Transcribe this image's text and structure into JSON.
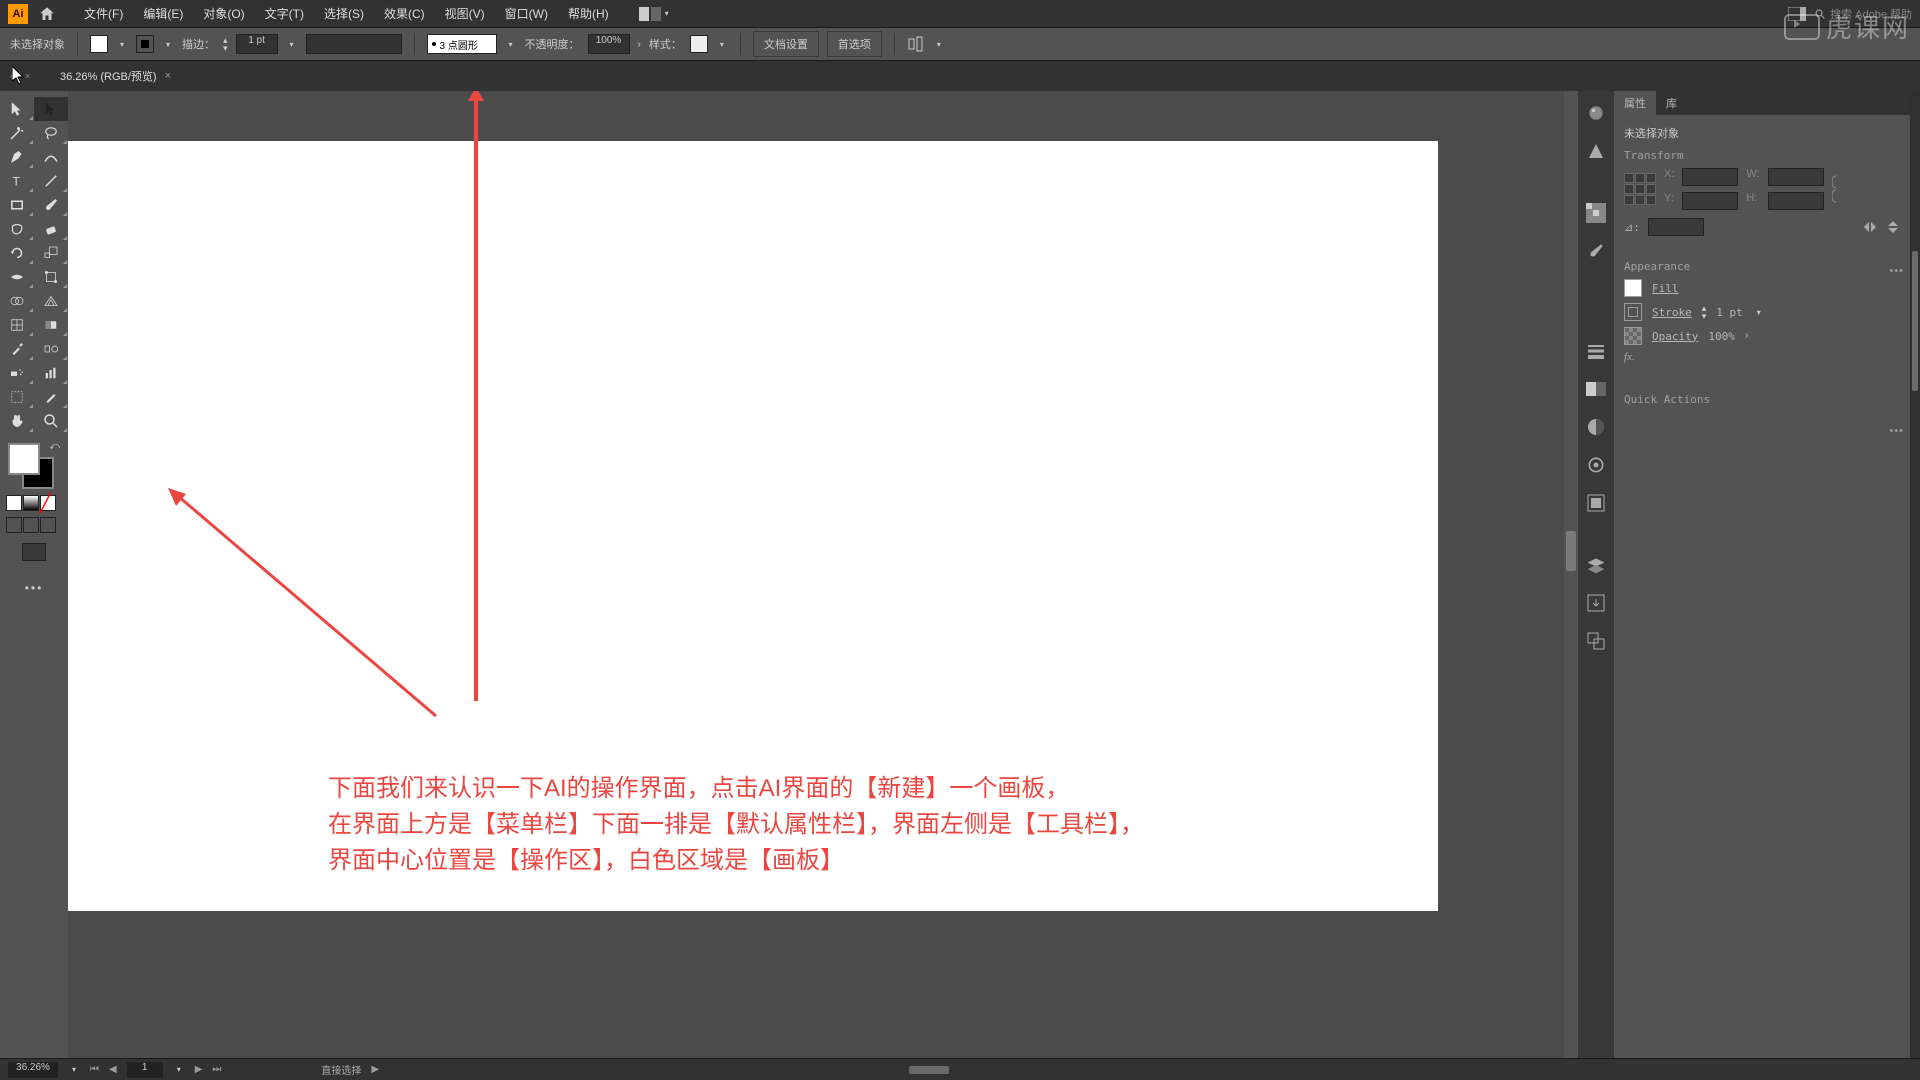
{
  "menubar": {
    "items": [
      "文件(F)",
      "编辑(E)",
      "对象(O)",
      "文字(T)",
      "选择(S)",
      "效果(C)",
      "视图(V)",
      "窗口(W)",
      "帮助(H)"
    ],
    "search_placeholder": "搜索 Adobe 帮助"
  },
  "optionsbar": {
    "no_selection": "未选择对象",
    "stroke_label": "描边：",
    "stroke_value": "1 pt",
    "brush_label": "3 点圆形",
    "opacity_label": "不透明度：",
    "opacity_value": "100%",
    "style_label": "样式：",
    "doc_setup": "文档设置",
    "preferences": "首选项"
  },
  "tab": {
    "title": "36.26% (RGB/预览)"
  },
  "annotation": {
    "line1": "下面我们来认识一下AI的操作界面，点击AI界面的【新建】一个画板，",
    "line2": "在界面上方是【菜单栏】下面一排是【默认属性栏】，界面左侧是【工具栏】，",
    "line3": "界面中心位置是【操作区】，白色区域是【画板】"
  },
  "panel": {
    "tabs": {
      "properties": "属性",
      "library": "库"
    },
    "no_selection": "未选择对象",
    "transform": {
      "title": "Transform",
      "x_label": "X:",
      "x_value": "",
      "y_label": "Y:",
      "y_value": "",
      "w_label": "W:",
      "w_value": "",
      "h_label": "H:",
      "h_value": "",
      "angle_label": "⊿:"
    },
    "appearance": {
      "title": "Appearance",
      "fill": "Fill",
      "stroke": "Stroke",
      "stroke_value": "1 pt",
      "opacity": "Opacity",
      "opacity_value": "100%",
      "fx": "fx."
    },
    "quick_actions": "Quick Actions"
  },
  "statusbar": {
    "zoom": "36.26%",
    "artboard": "1",
    "tool_hint": "直接选择"
  },
  "watermark": "虎课网"
}
